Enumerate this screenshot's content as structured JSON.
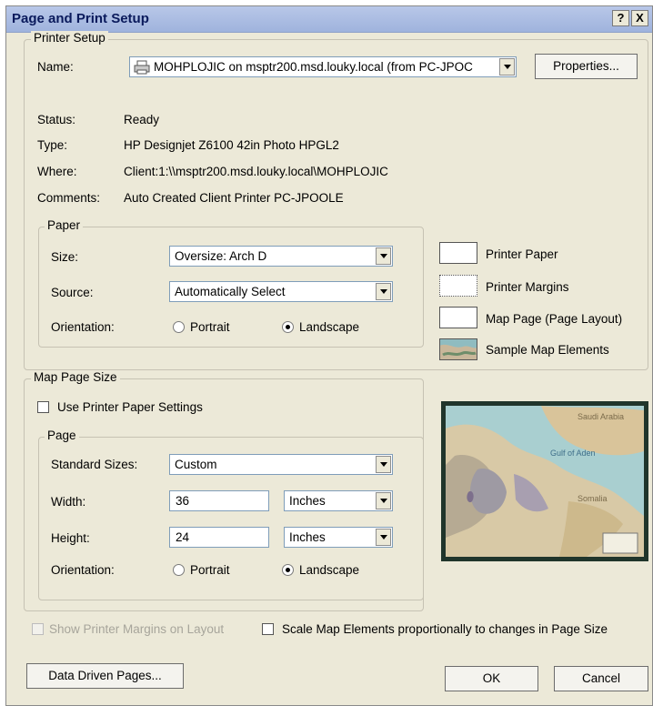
{
  "window": {
    "title": "Page and Print Setup",
    "help_label": "?",
    "close_label": "X"
  },
  "printer_setup": {
    "legend": "Printer Setup",
    "name_label": "Name:",
    "name_value": "MOHPLOJIC on msptr200.msd.louky.local (from PC-JPOC",
    "properties_label": "Properties...",
    "status_label": "Status:",
    "status_value": "Ready",
    "type_label": "Type:",
    "type_value": "HP Designjet Z6100 42in Photo HPGL2",
    "where_label": "Where:",
    "where_value": "Client:1:\\\\msptr200.msd.louky.local\\MOHPLOJIC",
    "comments_label": "Comments:",
    "comments_value": "Auto Created Client Printer PC-JPOOLE"
  },
  "paper": {
    "legend": "Paper",
    "size_label": "Size:",
    "size_value": "Oversize: Arch D",
    "source_label": "Source:",
    "source_value": "Automatically Select",
    "orientation_label": "Orientation:",
    "portrait_label": "Portrait",
    "landscape_label": "Landscape",
    "selected": "Landscape"
  },
  "legend_panel": {
    "printer_paper": "Printer Paper",
    "printer_margins": "Printer Margins",
    "map_page": "Map Page (Page Layout)",
    "sample_elements": "Sample Map Elements"
  },
  "map_page_size": {
    "legend": "Map Page Size",
    "use_printer_settings_label": "Use Printer Paper Settings",
    "use_printer_settings_checked": false,
    "page_legend": "Page",
    "standard_sizes_label": "Standard Sizes:",
    "standard_sizes_value": "Custom",
    "width_label": "Width:",
    "width_value": "36",
    "width_unit": "Inches",
    "height_label": "Height:",
    "height_value": "24",
    "height_unit": "Inches",
    "orientation_label": "Orientation:",
    "portrait_label": "Portrait",
    "landscape_label": "Landscape",
    "selected": "Landscape"
  },
  "preview": {
    "map_labels": [
      "Saudi Arabia",
      "Gulf of Aden",
      "Somalia"
    ]
  },
  "options": {
    "show_margins_label": "Show Printer Margins on Layout",
    "scale_elements_label": "Scale Map Elements proportionally to changes in Page Size"
  },
  "buttons": {
    "data_driven_pages": "Data Driven Pages...",
    "ok": "OK",
    "cancel": "Cancel"
  },
  "colors": {
    "dialog_bg": "#ece9d8",
    "title_text": "#0a1a5c",
    "disabled_text": "#a7a59b",
    "input_border": "#7f9db9"
  }
}
